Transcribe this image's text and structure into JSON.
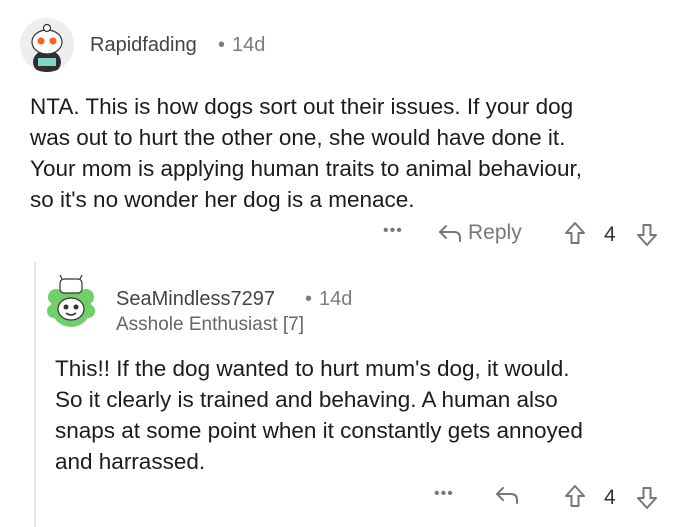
{
  "comment": {
    "username": "Rapidfading",
    "separator": "•",
    "age": "14d",
    "body_lines": [
      "NTA. This is how dogs sort out their issues. If your dog",
      "was out to hurt the other one, she would have done it.",
      "Your mom is applying human traits to animal behaviour,",
      "so it's no wonder her dog is a menace."
    ],
    "more_label": "•••",
    "reply_label": "Reply",
    "vote_count": "4"
  },
  "reply": {
    "username": "SeaMindless7297",
    "separator": "•",
    "age": "14d",
    "flair": "Asshole Enthusiast [7]",
    "body_lines": [
      "This!! If the dog wanted to hurt mum's dog, it would.",
      "So it clearly is trained and behaving. A human also",
      "snaps at some point when it constantly gets annoyed",
      "and harrassed."
    ],
    "more_label": "•••",
    "vote_count": "4"
  },
  "colors": {
    "text": "#1c1c1c",
    "meta": "#7c7c7c",
    "thread_line": "#e6e6e6",
    "avatar_green": "#6fcf6a"
  }
}
